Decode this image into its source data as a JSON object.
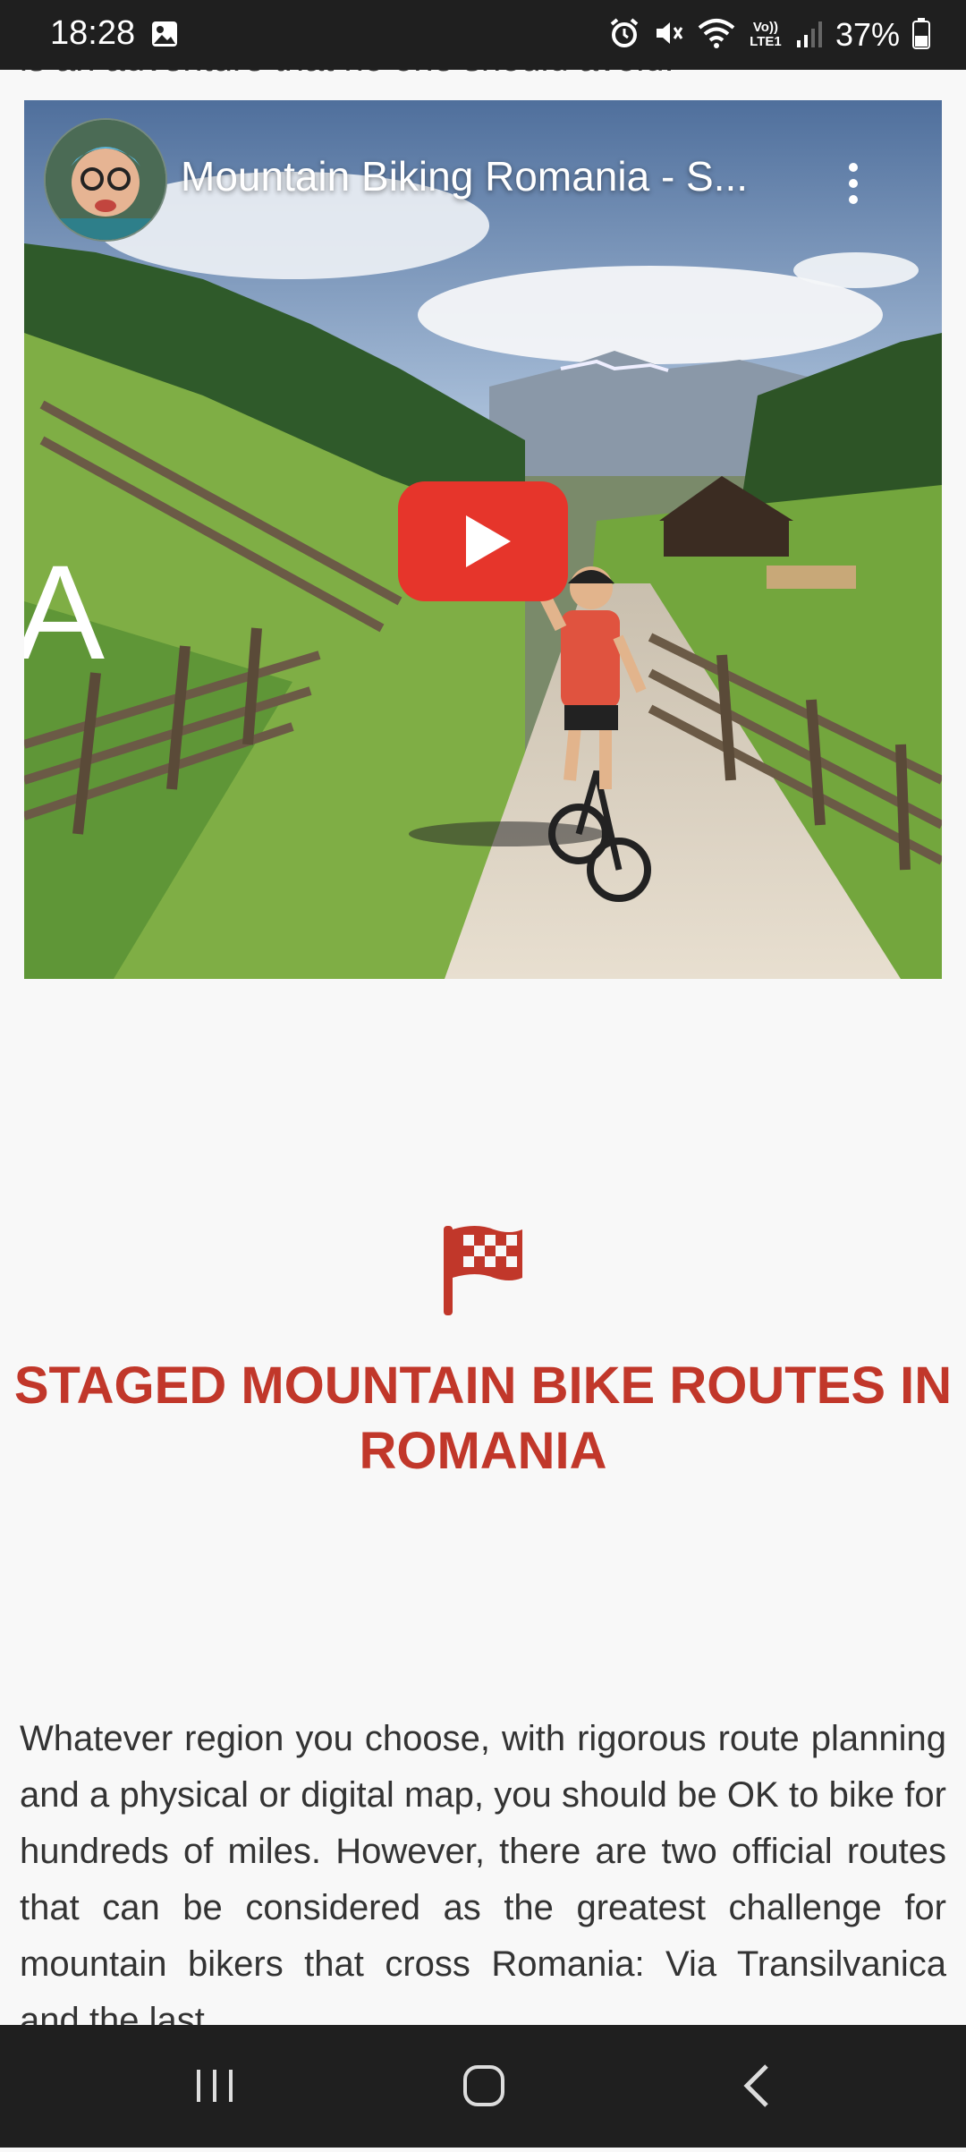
{
  "status_bar": {
    "time": "18:28",
    "battery": "37%",
    "network_label": "Vo)) LTE1",
    "icons": [
      "image-icon",
      "alarm-icon",
      "mute-icon",
      "wifi-icon",
      "signal-icon",
      "battery-icon"
    ]
  },
  "page": {
    "cut_off_text": "is an adventure that no one should avoid.",
    "video": {
      "title": "Mountain Biking Romania - S...",
      "side_letter": "A"
    },
    "section_icon": "checkered-flag-icon",
    "section_title": "STAGED MOUNTAIN BIKE ROUTES IN ROMANIA",
    "paragraph": "Whatever region you choose, with rigorous route planning and a physical or digital map, you should be OK to bike for hundreds of miles. However, there are two official routes that can be considered as the greatest challenge for mountain bikers that cross Romania: Via Transilvanica and the last"
  },
  "colors": {
    "accent": "#c1372a",
    "play_button": "#e6352b",
    "status_bar": "#1f1f1f"
  },
  "nav_bar": {
    "icons": [
      "recents-icon",
      "home-icon",
      "back-icon"
    ]
  }
}
